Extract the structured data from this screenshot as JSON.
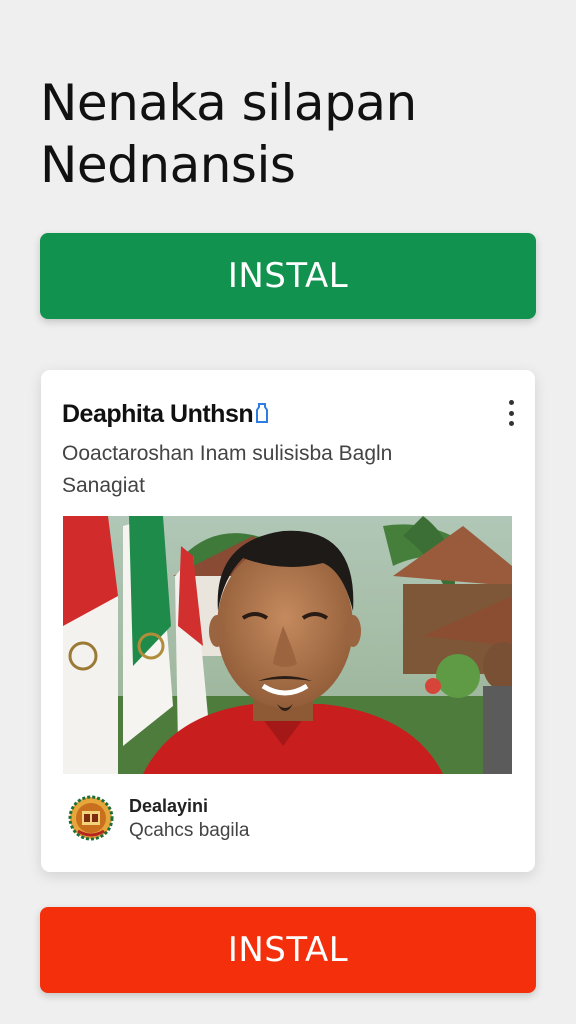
{
  "headline": {
    "line1": "Nenaka silapan",
    "line2": "Nednansis"
  },
  "buttons": {
    "top_label": "INSTAL",
    "bottom_label": "INSTAL"
  },
  "card": {
    "title": "Deaphita Unthsn",
    "description_line1": "Ooactaroshan Inam sulisisba Bagln",
    "description_line2": "Sanagiat",
    "advertiser_name": "Dealayini",
    "advertiser_sub": "Qcahcs bagila",
    "icons": [
      "verified-icon",
      "more-vert-icon",
      "close-icon"
    ]
  },
  "colors": {
    "install_green": "#12924f",
    "install_red": "#f4300c",
    "background": "#efefef"
  }
}
